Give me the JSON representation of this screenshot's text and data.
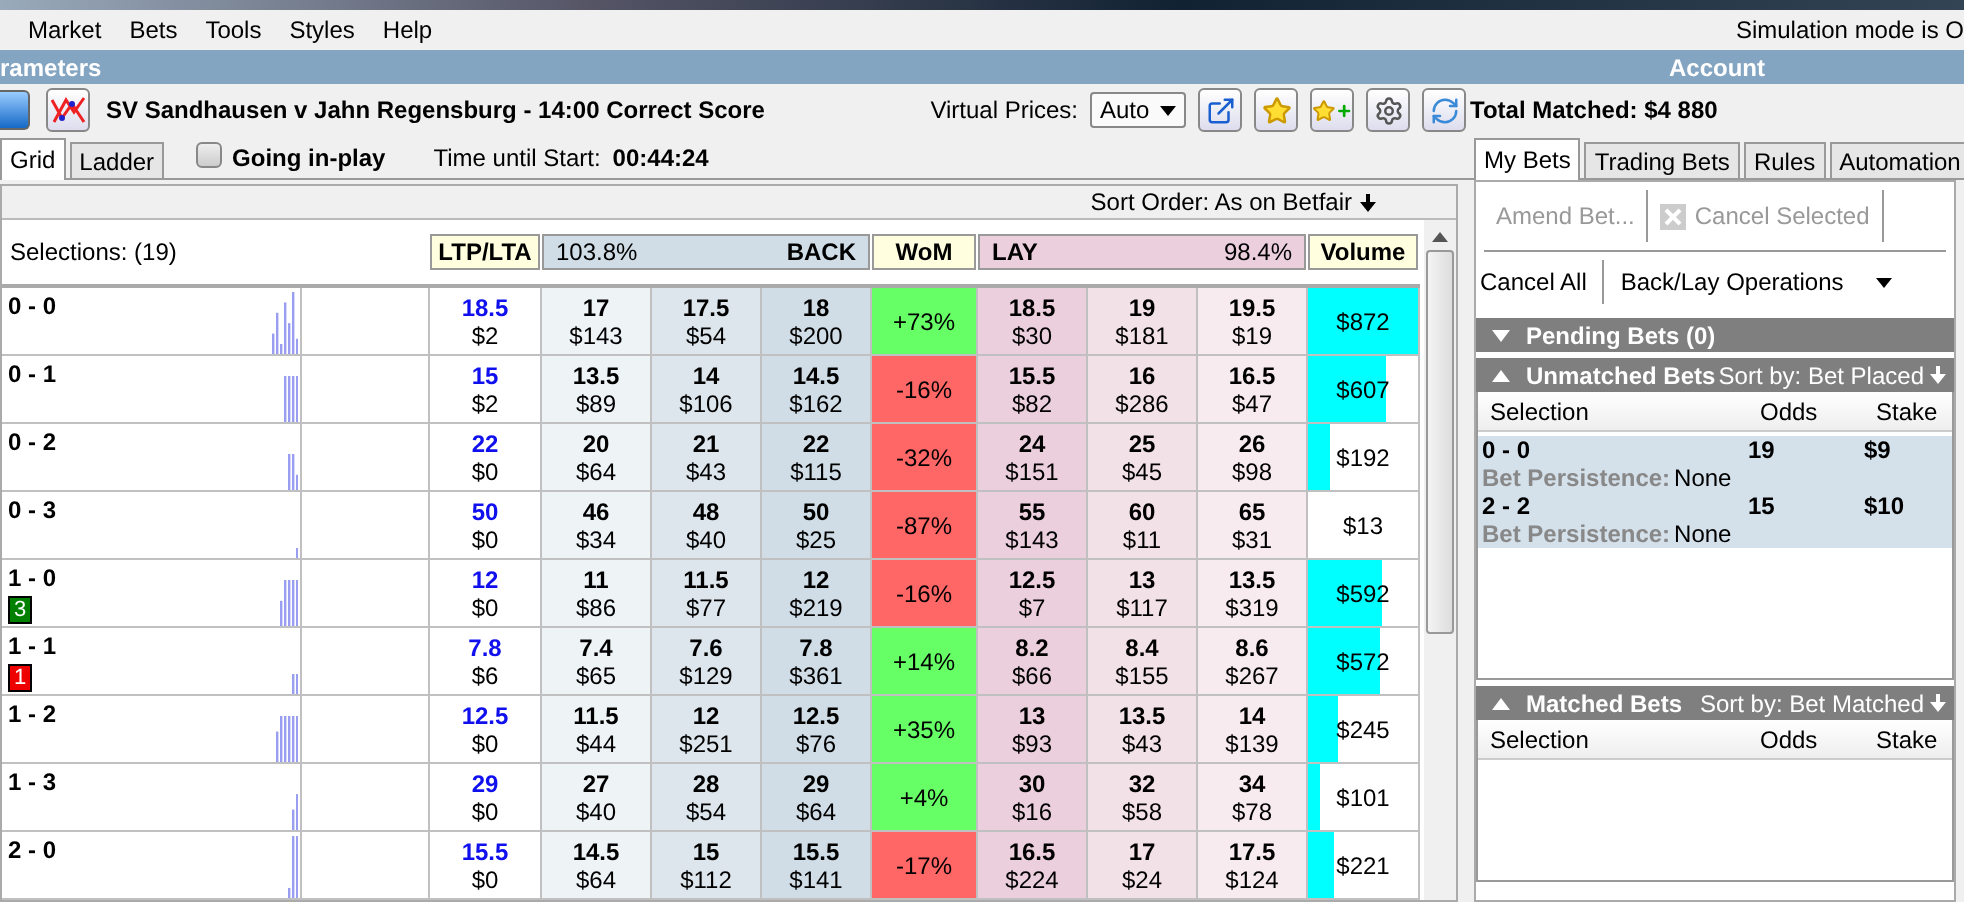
{
  "menu": [
    "Market",
    "Bets",
    "Tools",
    "Styles",
    "Help"
  ],
  "simulation_notice": "Simulation mode is O",
  "left_panel": {
    "title": "rameters",
    "market_title": "SV Sandhausen v Jahn Regensburg - 14:00 Correct Score",
    "virtual_prices": {
      "label": "Virtual Prices:",
      "value": "Auto"
    },
    "view_tabs": [
      {
        "label": "Grid",
        "selected": true
      },
      {
        "label": "Ladder",
        "selected": false
      }
    ],
    "going_in_play": {
      "label": "Going in-play",
      "checked": false
    },
    "time_until_start": {
      "label": "Time until Start:",
      "value": "00:44:24"
    },
    "sort_order": "Sort Order: As on Betfair",
    "selections_label": "Selections: (19)",
    "ltp_header": "LTP/LTA",
    "back_header": {
      "label": "BACK",
      "book": "103.8%"
    },
    "wom_header": "WoM",
    "lay_header": {
      "label": "LAY",
      "book": "98.4%"
    },
    "volume_header": "Volume",
    "rows": [
      {
        "name": "0 - 0",
        "ltp": {
          "price": "18.5",
          "amount": "$2"
        },
        "back": [
          {
            "price": "17",
            "amount": "$143"
          },
          {
            "price": "17.5",
            "amount": "$54"
          },
          {
            "price": "18",
            "amount": "$200"
          }
        ],
        "wom": {
          "text": "+73%",
          "color": "#66ff66"
        },
        "lay": [
          {
            "price": "18.5",
            "amount": "$30"
          },
          {
            "price": "19",
            "amount": "$181"
          },
          {
            "price": "19.5",
            "amount": "$19"
          }
        ],
        "volume": {
          "text": "$872",
          "level": 1
        }
      },
      {
        "name": "0 - 1",
        "ltp": {
          "price": "15",
          "amount": "$2"
        },
        "back": [
          {
            "price": "13.5",
            "amount": "$89"
          },
          {
            "price": "14",
            "amount": "$106"
          },
          {
            "price": "14.5",
            "amount": "$162"
          }
        ],
        "wom": {
          "text": "-16%",
          "color": "#ff6666"
        },
        "lay": [
          {
            "price": "15.5",
            "amount": "$82"
          },
          {
            "price": "16",
            "amount": "$286"
          },
          {
            "price": "16.5",
            "amount": "$47"
          }
        ],
        "volume": {
          "text": "$607",
          "level": 0.7
        }
      },
      {
        "name": "0 - 2",
        "ltp": {
          "price": "22",
          "amount": "$0"
        },
        "back": [
          {
            "price": "20",
            "amount": "$64"
          },
          {
            "price": "21",
            "amount": "$43"
          },
          {
            "price": "22",
            "amount": "$115"
          }
        ],
        "wom": {
          "text": "-32%",
          "color": "#ff6666"
        },
        "lay": [
          {
            "price": "24",
            "amount": "$151"
          },
          {
            "price": "25",
            "amount": "$45"
          },
          {
            "price": "26",
            "amount": "$98"
          }
        ],
        "volume": {
          "text": "$192",
          "level": 0.2
        }
      },
      {
        "name": "0 - 3",
        "ltp": {
          "price": "50",
          "amount": "$0"
        },
        "back": [
          {
            "price": "46",
            "amount": "$34"
          },
          {
            "price": "48",
            "amount": "$40"
          },
          {
            "price": "50",
            "amount": "$25"
          }
        ],
        "wom": {
          "text": "-87%",
          "color": "#ff6666"
        },
        "lay": [
          {
            "price": "55",
            "amount": "$143"
          },
          {
            "price": "60",
            "amount": "$11"
          },
          {
            "price": "65",
            "amount": "$31"
          }
        ],
        "volume": {
          "text": "$13"
        }
      },
      {
        "name": "1 - 0",
        "badge": {
          "text": "3",
          "color": "#008000"
        },
        "ltp": {
          "price": "12",
          "amount": "$0"
        },
        "back": [
          {
            "price": "11",
            "amount": "$86"
          },
          {
            "price": "11.5",
            "amount": "$77"
          },
          {
            "price": "12",
            "amount": "$219"
          }
        ],
        "wom": {
          "text": "-16%",
          "color": "#ff6666"
        },
        "lay": [
          {
            "price": "12.5",
            "amount": "$7"
          },
          {
            "price": "13",
            "amount": "$117"
          },
          {
            "price": "13.5",
            "amount": "$319"
          }
        ],
        "volume": {
          "text": "$592",
          "level": 0.68
        }
      },
      {
        "name": "1 - 1",
        "badge": {
          "text": "1",
          "color": "#ee0000"
        },
        "ltp": {
          "price": "7.8",
          "amount": "$6"
        },
        "back": [
          {
            "price": "7.4",
            "amount": "$65"
          },
          {
            "price": "7.6",
            "amount": "$129"
          },
          {
            "price": "7.8",
            "amount": "$361"
          }
        ],
        "wom": {
          "text": "+14%",
          "color": "#66ff66"
        },
        "lay": [
          {
            "price": "8.2",
            "amount": "$66"
          },
          {
            "price": "8.4",
            "amount": "$155"
          },
          {
            "price": "8.6",
            "amount": "$267"
          }
        ],
        "volume": {
          "text": "$572",
          "level": 0.66
        }
      },
      {
        "name": "1 - 2",
        "ltp": {
          "price": "12.5",
          "amount": "$0"
        },
        "back": [
          {
            "price": "11.5",
            "amount": "$44"
          },
          {
            "price": "12",
            "amount": "$251"
          },
          {
            "price": "12.5",
            "amount": "$76"
          }
        ],
        "wom": {
          "text": "+35%",
          "color": "#66ff66"
        },
        "lay": [
          {
            "price": "13",
            "amount": "$93"
          },
          {
            "price": "13.5",
            "amount": "$43"
          },
          {
            "price": "14",
            "amount": "$139"
          }
        ],
        "volume": {
          "text": "$245",
          "level": 0.27
        }
      },
      {
        "name": "1 - 3",
        "ltp": {
          "price": "29",
          "amount": "$0"
        },
        "back": [
          {
            "price": "27",
            "amount": "$40"
          },
          {
            "price": "28",
            "amount": "$54"
          },
          {
            "price": "29",
            "amount": "$64"
          }
        ],
        "wom": {
          "text": "+4%",
          "color": "#66ff66"
        },
        "lay": [
          {
            "price": "30",
            "amount": "$16"
          },
          {
            "price": "32",
            "amount": "$58"
          },
          {
            "price": "34",
            "amount": "$78"
          }
        ],
        "volume": {
          "text": "$101",
          "level": 0.11
        }
      },
      {
        "name": "2 - 0",
        "ltp": {
          "price": "15.5",
          "amount": "$0"
        },
        "back": [
          {
            "price": "14.5",
            "amount": "$64"
          },
          {
            "price": "15",
            "amount": "$112"
          },
          {
            "price": "15.5",
            "amount": "$141"
          }
        ],
        "wom": {
          "text": "-17%",
          "color": "#ff6666"
        },
        "lay": [
          {
            "price": "16.5",
            "amount": "$224"
          },
          {
            "price": "17",
            "amount": "$24"
          },
          {
            "price": "17.5",
            "amount": "$124"
          }
        ],
        "volume": {
          "text": "$221",
          "level": 0.23
        }
      }
    ]
  },
  "right_panel": {
    "title": "Account",
    "total_matched": "Total Matched: $4 880",
    "tabs": [
      {
        "label": "My Bets",
        "selected": true
      },
      {
        "label": "Trading Bets",
        "selected": false
      },
      {
        "label": "Rules",
        "selected": false
      },
      {
        "label": "Automation",
        "selected": false
      }
    ],
    "actions": [
      {
        "label": "Amend Bet...",
        "disabled": true
      },
      {
        "label": "Cancel Selected",
        "disabled": true
      }
    ],
    "cancel_all": "Cancel All",
    "operations": "Back/Lay Operations",
    "pending": {
      "title": "Pending Bets (0)",
      "expanded": false
    },
    "unmatched": {
      "title": "Unmatched Bets",
      "expanded": true,
      "sort": "Sort by: Bet Placed",
      "columns": [
        "Selection",
        "Odds",
        "Stake"
      ],
      "bets": [
        {
          "selection": "0 - 0",
          "odds": "19",
          "stake": "$9",
          "persistence_label": "Bet Persistence:",
          "persistence": "None"
        },
        {
          "selection": "2 - 2",
          "odds": "15",
          "stake": "$10",
          "persistence_label": "Bet Persistence:",
          "persistence": "None"
        }
      ]
    },
    "matched": {
      "title": "Matched Bets",
      "expanded": true,
      "sort": "Sort by: Bet Matched",
      "columns": [
        "Selection",
        "Odds",
        "Stake"
      ]
    }
  }
}
